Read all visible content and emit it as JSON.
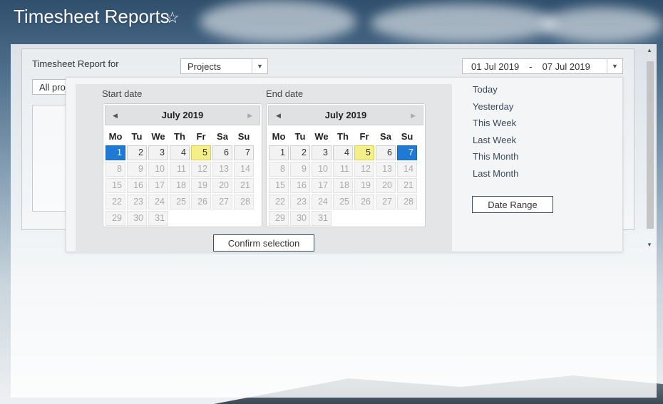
{
  "page": {
    "title": "Timesheet Reports",
    "favorite_icon": "star-outline-icon"
  },
  "filters": {
    "report_for_label": "Timesheet Report for",
    "report_type": "Projects",
    "project_scope": "All projects",
    "date_from": "01 Jul 2019",
    "date_separator": "-",
    "date_to": "07 Jul 2019"
  },
  "date_picker": {
    "start_label": "Start date",
    "end_label": "End date",
    "weekdays": [
      "Mo",
      "Tu",
      "We",
      "Th",
      "Fr",
      "Sa",
      "Su"
    ],
    "start_calendar": {
      "month_label": "July 2019",
      "selected_day": 1,
      "today": 5
    },
    "end_calendar": {
      "month_label": "July 2019",
      "selected_day": 7,
      "today": 5
    },
    "confirm_label": "Confirm selection"
  },
  "presets": {
    "items": [
      "Today",
      "Yesterday",
      "This Week",
      "Last Week",
      "This Month",
      "Last Month"
    ],
    "date_range_label": "Date Range"
  },
  "colors": {
    "selected": "#1f7ad6",
    "today": "#f5ef8a",
    "accent": "#3a4b5c"
  }
}
